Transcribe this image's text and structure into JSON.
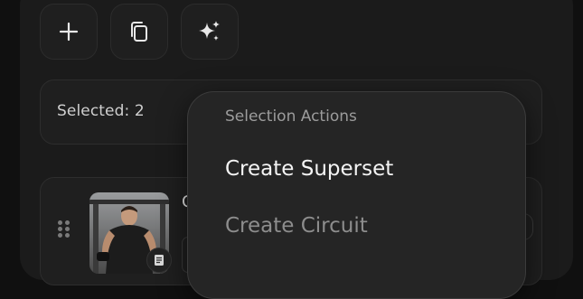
{
  "toolbar": {
    "buttons": [
      {
        "icon": "plus-icon"
      },
      {
        "icon": "copy-icon"
      },
      {
        "icon": "sparkles-icon"
      }
    ]
  },
  "selection": {
    "label": "Selected: 2"
  },
  "exercise_card": {
    "title_partial": "C",
    "thumbnail_icon": "document-icon"
  },
  "popover": {
    "header": "Selection Actions",
    "items": [
      {
        "label": "Create Superset",
        "state": "enabled"
      },
      {
        "label": "Create Circuit",
        "state": "disabled"
      }
    ]
  },
  "colors": {
    "background": "#101010",
    "panel": "#1b1b1b",
    "card": "#1f1f1f",
    "popover": "#252525",
    "text_primary": "#f4f4f4",
    "text_muted": "#8d8d8d"
  }
}
